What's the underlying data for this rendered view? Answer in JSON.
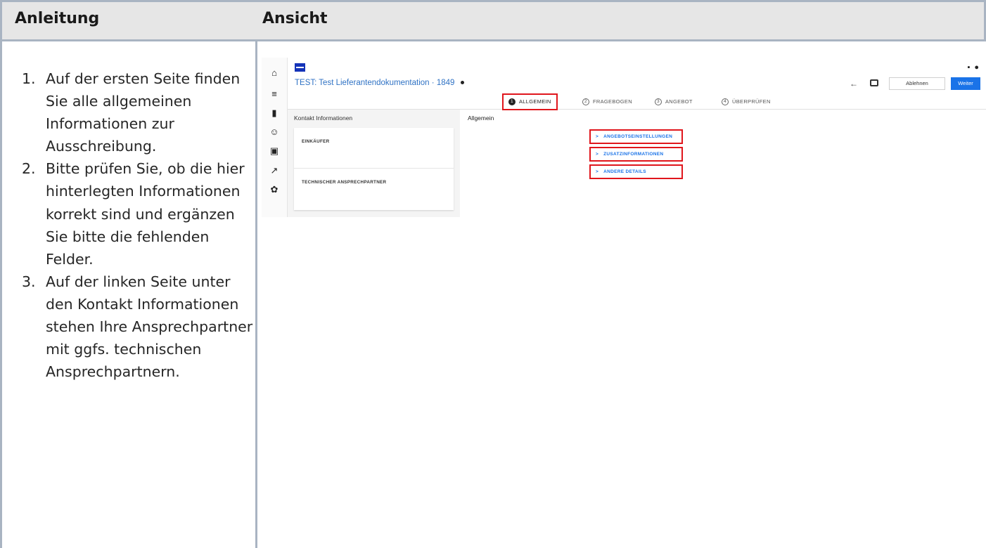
{
  "doc": {
    "header_left": "Anleitung",
    "header_right": "Ansicht",
    "steps": [
      {
        "num": "1.",
        "text": "Auf der ersten Seite finden Sie alle allgemeinen Informationen zur Ausschreibung."
      },
      {
        "num": "2.",
        "text": "Bitte prüfen Sie, ob die hier hinterlegten Informationen korrekt sind und ergänzen Sie bitte die fehlenden Felder."
      },
      {
        "num": "3.",
        "text": "Auf der linken Seite unter den Kontakt Informationen stehen Ihre Ansprechpartner mit ggfs. technischen Ansprechpartnern."
      }
    ]
  },
  "app": {
    "rail_icons": [
      "home-icon",
      "database-icon",
      "document-icon",
      "person-hand-icon",
      "bus-icon",
      "hammer-icon",
      "gear-icon"
    ],
    "top_icons": [
      "chat-icon",
      "user-icon"
    ],
    "title": "TEST: Test Lieferantendokumentation",
    "separator": "·",
    "number": "1849",
    "back_arrow": "←",
    "reject_label": "Ablehnen",
    "next_label": "Weiter",
    "steps": [
      {
        "num": "1",
        "label": "ALLGEMEIN",
        "active": true
      },
      {
        "num": "2",
        "label": "FRAGEBOGEN",
        "active": false
      },
      {
        "num": "3",
        "label": "ANGEBOT",
        "active": false
      },
      {
        "num": "4",
        "label": "ÜBERPRÜFEN",
        "active": false
      }
    ],
    "contact_title": "Kontakt Informationen",
    "buyer_label": "EINKÄUFER",
    "tech_contact_label": "TECHNISCHER ANSPRECHPARTNER",
    "general_title": "Allgemein",
    "accordions": [
      "ANGEBOTSEINSTELLUNGEN",
      "ZUSATZINFORMATIONEN",
      "ANDERE DETAILS"
    ],
    "chevron": ">"
  },
  "colors": {
    "highlight": "#e0161c",
    "link": "#2f72c4",
    "primary": "#1a73e8",
    "table_border": "#a9b4c2",
    "header_bg": "#e6e6e6",
    "logo": "#1433b8"
  }
}
